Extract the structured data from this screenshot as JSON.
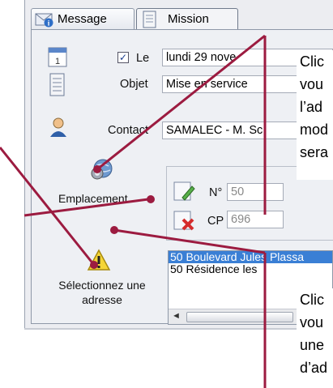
{
  "tabs": [
    {
      "label": "Message",
      "icon": "envelope-info-icon"
    },
    {
      "label": "Mission",
      "icon": "document-icon"
    }
  ],
  "form": {
    "le_label": "Le",
    "le_checked": true,
    "date_value": "lundi    29 nove",
    "objet_label": "Objet",
    "objet_value": "Mise en service",
    "contact_label": "Contact",
    "contact_value": "SAMALEC - M. Sc"
  },
  "emplacement": {
    "label": "Emplacement",
    "icon": "location-globe-icon",
    "numero_label": "N°",
    "numero_value": "50",
    "cp_label": "CP",
    "cp_value": "696",
    "edit_icon": "edit-address-icon",
    "delete_icon": "delete-address-icon"
  },
  "warning": {
    "icon": "warning-icon",
    "text_line1": "Sélectionnez une",
    "text_line2": "adresse"
  },
  "address_list": [
    {
      "text": "50 Boulevard Jules Plassa",
      "selected": true
    },
    {
      "text": "50 Résidence les",
      "selected": false
    }
  ],
  "callouts": {
    "top": [
      "Clic",
      "vou",
      "l’ad",
      "mod",
      "sera"
    ],
    "bottom": [
      "Clic",
      "vou",
      "une",
      "d’ad"
    ]
  },
  "colors": {
    "accent": "#9c1b40",
    "selection": "#3a7fd5"
  }
}
